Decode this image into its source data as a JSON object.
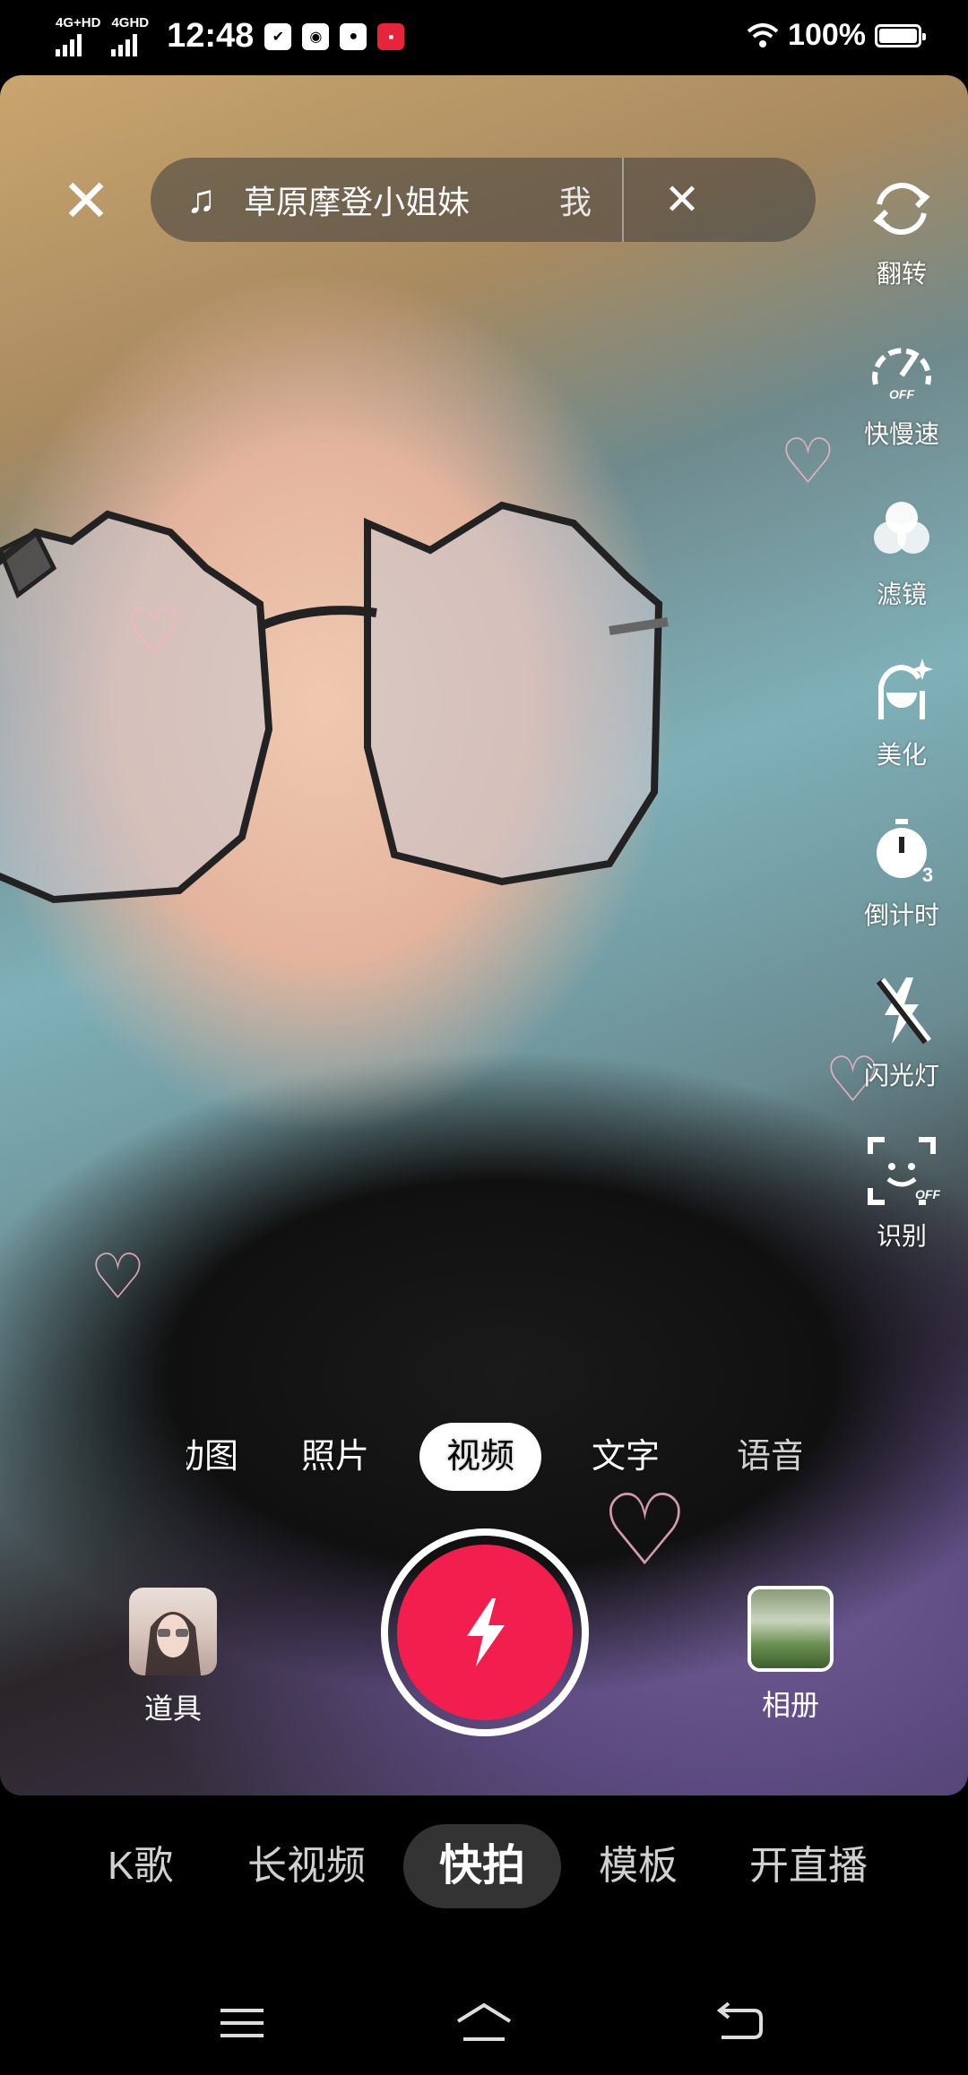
{
  "status_bar": {
    "signal1_label": "4G+HD",
    "signal2_label": "4GHD",
    "time": "12:48",
    "battery_text": "100%"
  },
  "music": {
    "title": "草原摩登小姐妹",
    "title_trail": "我"
  },
  "tools": [
    {
      "label": "翻转",
      "icon": "flip-camera-icon"
    },
    {
      "label": "快慢速",
      "icon": "speed-off-icon"
    },
    {
      "label": "滤镜",
      "icon": "filter-icon"
    },
    {
      "label": "美化",
      "icon": "beautify-icon"
    },
    {
      "label": "倒计时",
      "icon": "countdown-3-icon"
    },
    {
      "label": "闪光灯",
      "icon": "flash-off-icon"
    },
    {
      "label": "识别",
      "icon": "face-recognition-off-icon"
    }
  ],
  "modes": [
    "动图",
    "照片",
    "视频",
    "文字",
    "语音"
  ],
  "active_mode": "视频",
  "props_label": "道具",
  "album_label": "相册",
  "tabs": [
    "K歌",
    "长视频",
    "快拍",
    "模板",
    "开直播"
  ],
  "active_tab": "快拍",
  "colors": {
    "shutter": "#f21f4e",
    "background": "#000000"
  }
}
